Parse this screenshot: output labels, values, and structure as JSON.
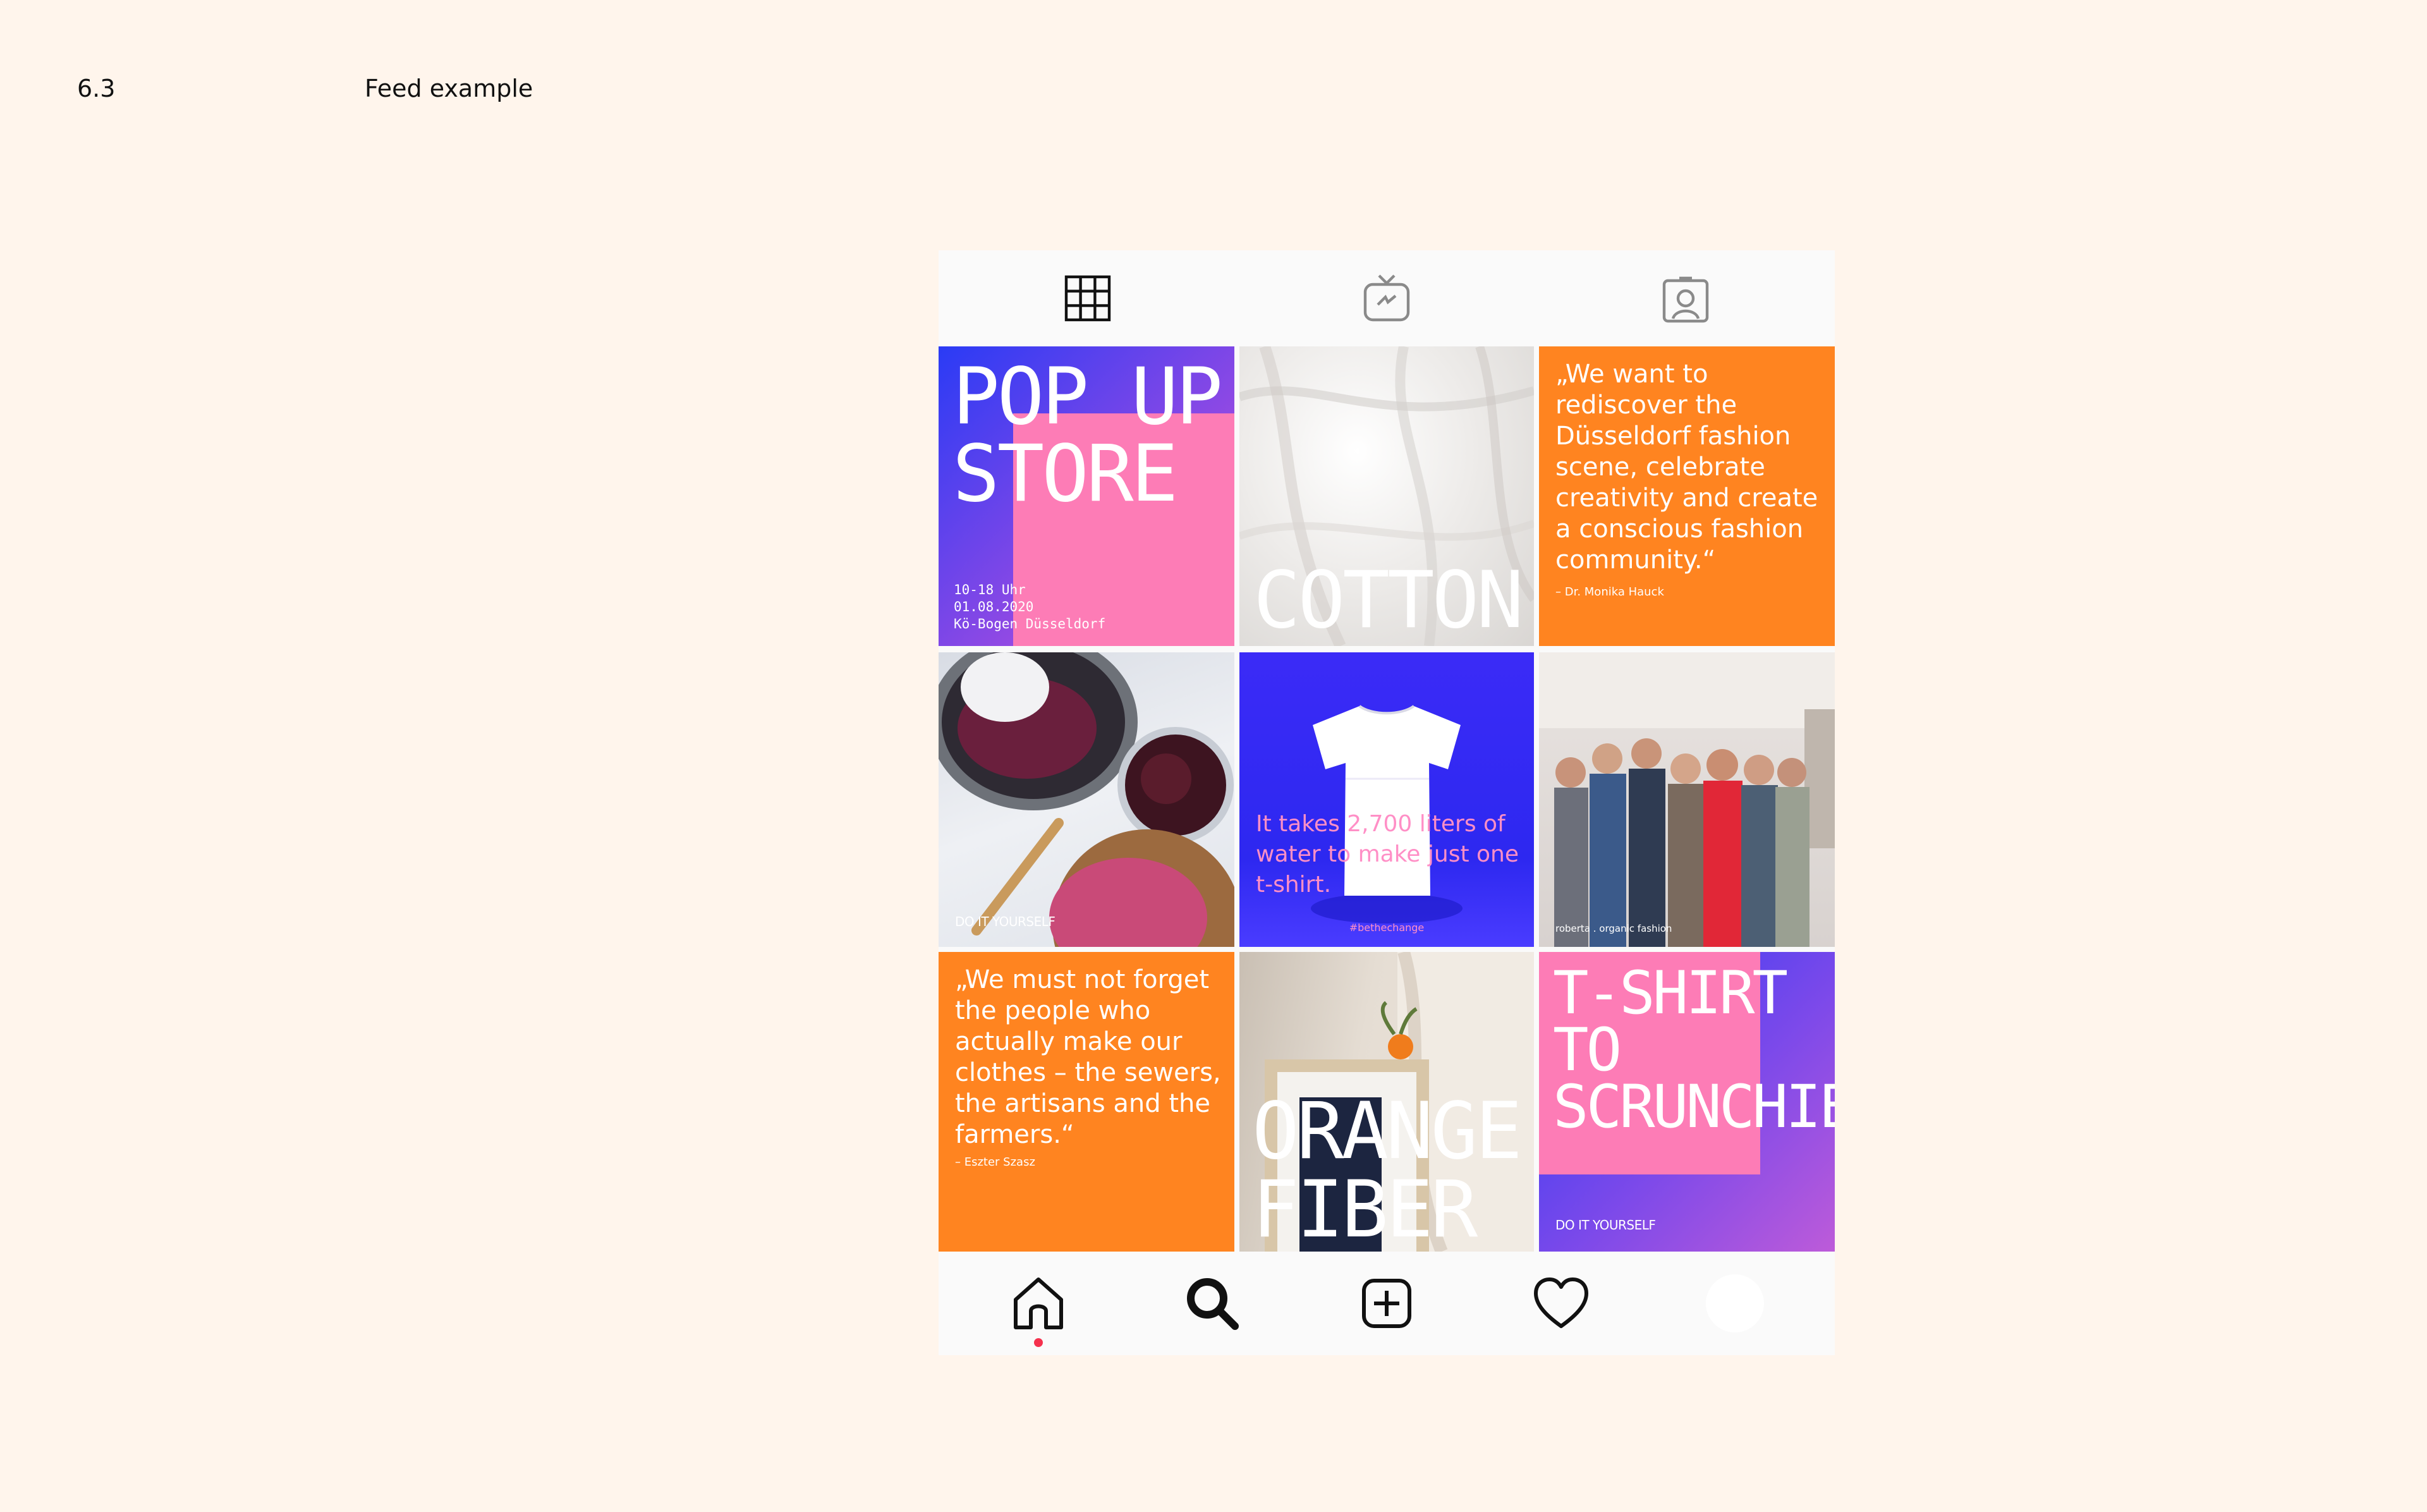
{
  "header": {
    "section_number": "6.3",
    "section_title": "Feed example"
  },
  "tabs": [
    {
      "icon": "grid-icon"
    },
    {
      "icon": "igtv-icon"
    },
    {
      "icon": "tagged-profile-icon"
    }
  ],
  "posts": {
    "popup": {
      "title_line1": "POP UP",
      "title_line2": "STORE",
      "time": "10-18 Uhr",
      "date": "01.08.2020",
      "location": "Kö-Bogen Düsseldorf"
    },
    "cotton": {
      "title": "COTTON"
    },
    "quote1": {
      "text": "„We want to rediscover the Düsseldorf fashion scene, celebrate creativity and create a conscious fashion community.“",
      "author": "– Dr. Monika Hauck"
    },
    "diy1": {
      "tag": "DO IT YOURSELF"
    },
    "tshirt_fact": {
      "text": "It takes 2,700 liters of water to make just one t-shirt.",
      "hashtag": "#bethechange"
    },
    "group": {
      "caption": "roberta . organic fashion"
    },
    "quote2": {
      "text": "„We must not forget the people who actually make our clothes – the sewers, the artisans and the farmers.“",
      "author": "– Eszter Szasz"
    },
    "orangefiber": {
      "title_line1": "ORANGE",
      "title_line2": "FIBER"
    },
    "scrunchie": {
      "title_line1": "T-SHIRT",
      "title_line2": "TO",
      "title_line3": "SCRUNCHIE",
      "tag": "DO IT YOURSELF"
    }
  },
  "bottom_nav": [
    {
      "icon": "home-icon",
      "active": true
    },
    {
      "icon": "search-icon"
    },
    {
      "icon": "add-post-icon"
    },
    {
      "icon": "heart-icon"
    },
    {
      "icon": "profile-avatar"
    }
  ],
  "colors": {
    "background": "#fff5ec",
    "orange": "#ff8420",
    "pink": "#fd7cb6",
    "blue": "#2a3bf5",
    "active_dot": "#f5314d"
  }
}
